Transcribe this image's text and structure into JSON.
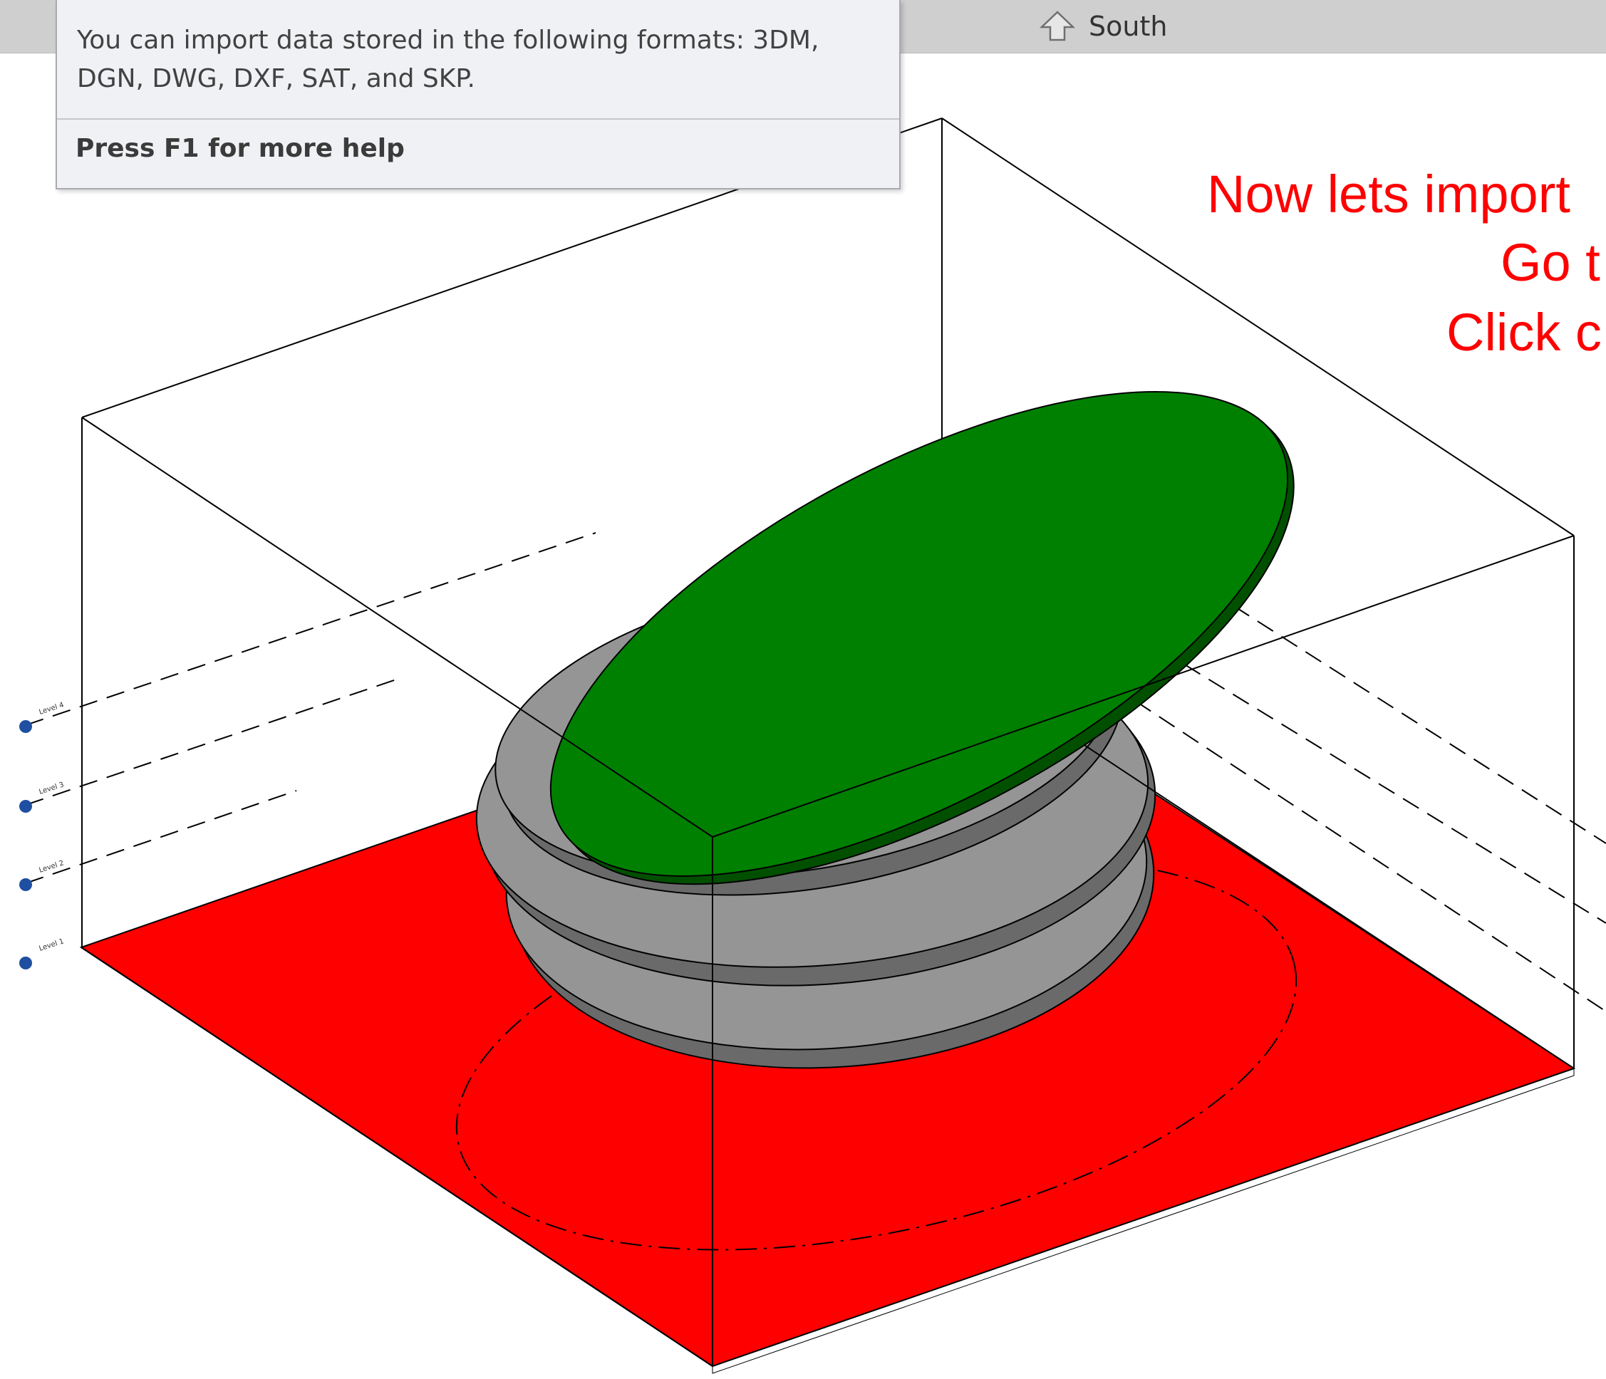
{
  "view_tab": {
    "label": "South",
    "icon": "home-icon"
  },
  "tooltip": {
    "description": "You can import data stored in the following formats: 3DM, DGN, DWG, DXF, SAT, and SKP.",
    "help": "Press F1 for more help"
  },
  "annotation": {
    "lines": [
      "Now lets import",
      "Go t",
      "Click c"
    ],
    "color": "#ff0000"
  },
  "scene": {
    "floor_color": "#ff0000",
    "roof_color": "#008000",
    "slab_color": "#959595",
    "levels": [
      {
        "name": "Level 4"
      },
      {
        "name": "Level 3"
      },
      {
        "name": "Level 2"
      },
      {
        "name": "Level 1"
      }
    ]
  }
}
